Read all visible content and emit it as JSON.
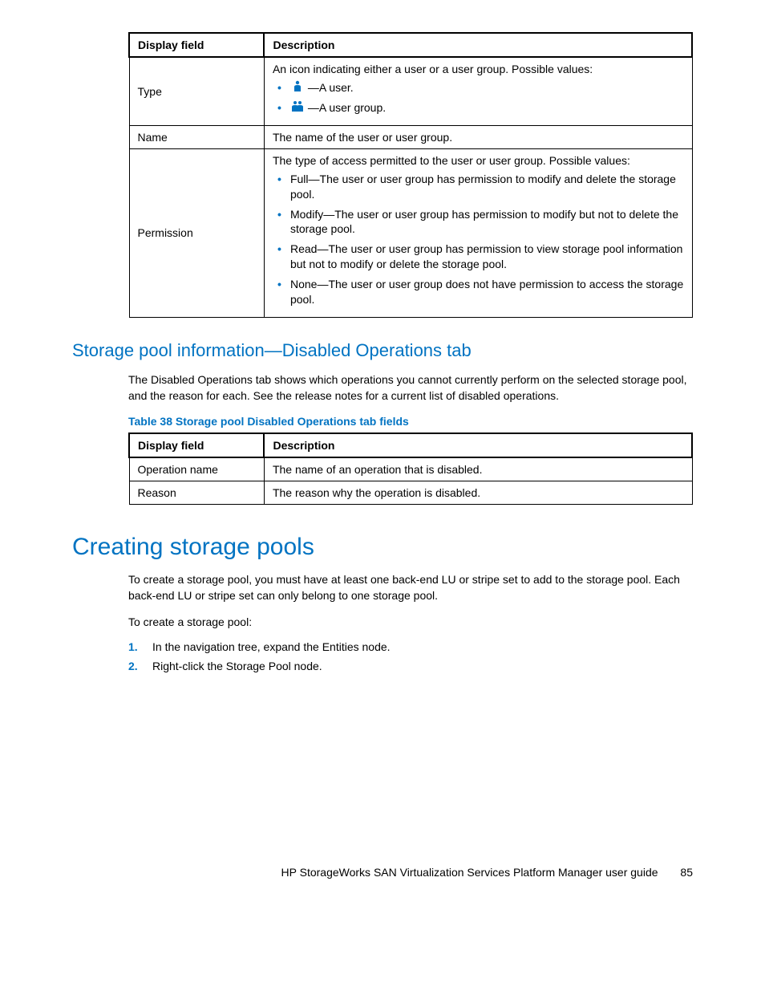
{
  "table1": {
    "headers": {
      "col1": "Display field",
      "col2": "Description"
    },
    "rows": {
      "type": {
        "field": "Type",
        "intro": "An icon indicating either a user or a user group. Possible values:",
        "bullets": [
          {
            "icon_name": "user-icon",
            "text": "—A user."
          },
          {
            "icon_name": "group-icon",
            "text": "—A user group."
          }
        ]
      },
      "name": {
        "field": "Name",
        "desc": "The name of the user or user group."
      },
      "permission": {
        "field": "Permission",
        "intro": "The type of access permitted to the user or user group. Possible values:",
        "bullets": [
          "Full—The user or user group has permission to modify and delete the storage pool.",
          "Modify—The user or user group has permission to modify but not to delete the storage pool.",
          "Read—The user or user group has permission to view storage pool information but not to modify or delete the storage pool.",
          "None—The user or user group does not have permission to access the storage pool."
        ]
      }
    }
  },
  "section1": {
    "heading": "Storage pool information—Disabled Operations tab",
    "para": "The Disabled Operations tab shows which operations you cannot currently perform on the selected storage pool, and the reason for each. See the release notes for a current list of disabled operations.",
    "table_caption": "Table 38 Storage pool Disabled Operations tab fields"
  },
  "table2": {
    "headers": {
      "col1": "Display field",
      "col2": "Description"
    },
    "rows": [
      {
        "field": "Operation name",
        "desc": "The name of an operation that is disabled."
      },
      {
        "field": "Reason",
        "desc": "The reason why the operation is disabled."
      }
    ]
  },
  "section2": {
    "heading": "Creating storage pools",
    "para1": "To create a storage pool, you must have at least one back-end LU or stripe set to add to the storage pool. Each back-end LU or stripe set can only belong to one storage pool.",
    "para2": "To create a storage pool:",
    "steps": [
      {
        "n": "1.",
        "text": "In the navigation tree, expand the Entities node."
      },
      {
        "n": "2.",
        "text": "Right-click the Storage Pool node."
      }
    ]
  },
  "footer": {
    "title": "HP StorageWorks SAN Virtualization Services Platform Manager user guide",
    "page": "85"
  }
}
